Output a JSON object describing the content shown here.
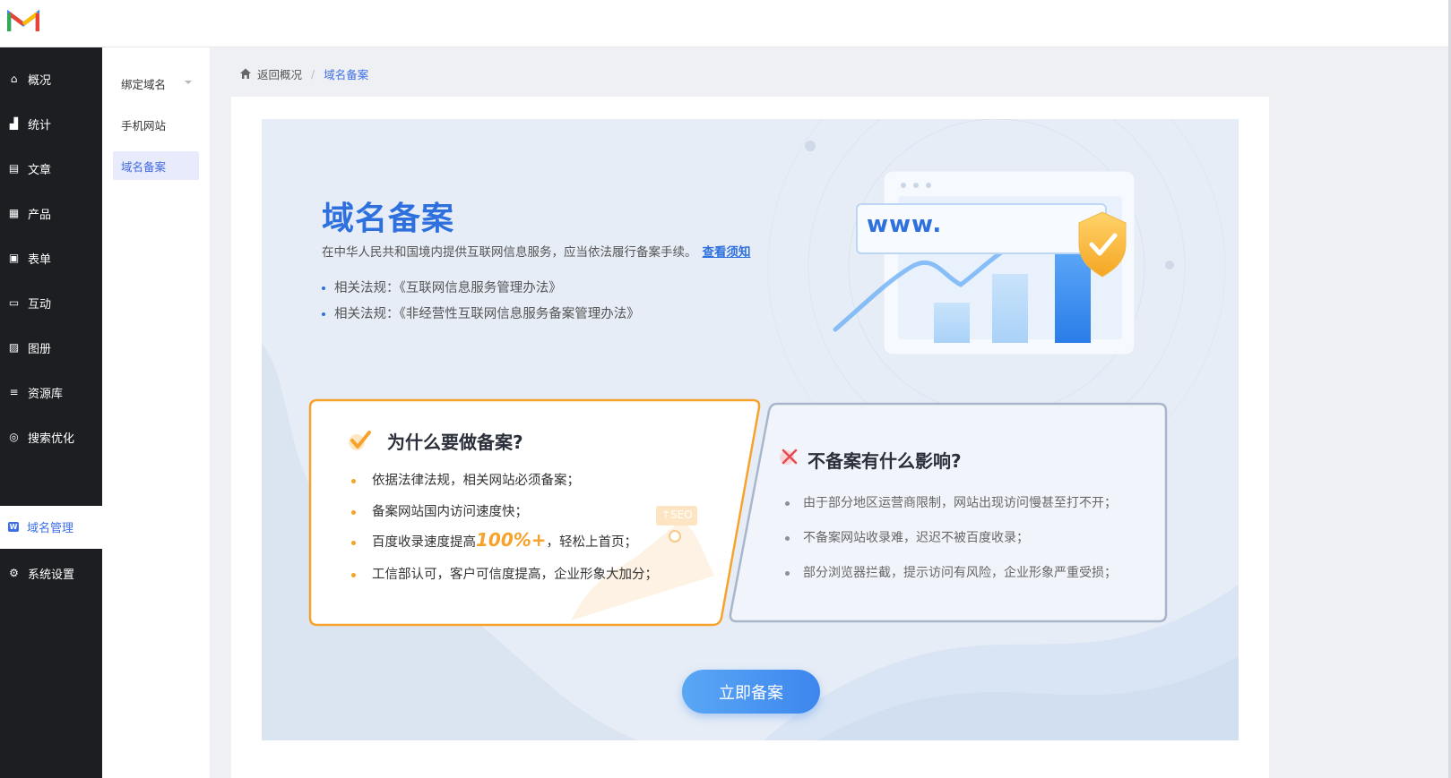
{
  "topbar": {
    "logo": "M-logo"
  },
  "sidebar": {
    "items": [
      {
        "label": "概况",
        "icon": "home-icon"
      },
      {
        "label": "统计",
        "icon": "stats-icon"
      },
      {
        "label": "文章",
        "icon": "article-icon"
      },
      {
        "label": "产品",
        "icon": "grid-icon"
      },
      {
        "label": "表单",
        "icon": "form-icon"
      },
      {
        "label": "互动",
        "icon": "chat-icon"
      },
      {
        "label": "图册",
        "icon": "gallery-icon"
      },
      {
        "label": "资源库",
        "icon": "database-icon"
      },
      {
        "label": "搜索优化",
        "icon": "seo-icon"
      },
      {
        "label": "域名管理",
        "icon": "domain-icon",
        "badge": "W",
        "active": true
      },
      {
        "label": "系统设置",
        "icon": "gear-icon"
      }
    ]
  },
  "submenu": {
    "items": [
      {
        "label": "绑定域名"
      },
      {
        "label": "手机网站"
      },
      {
        "label": "域名备案",
        "active": true
      }
    ]
  },
  "breadcrumb": {
    "back": "返回概况",
    "sep": "/",
    "current": "域名备案"
  },
  "hero": {
    "title": "域名备案",
    "desc": "在中华人民共和国境内提供互联网信息服务，应当依法履行备案手续。",
    "link": "查看须知",
    "laws": [
      "相关法规：《互联网信息服务管理办法》",
      "相关法规：《非经营性互联网信息服务备案管理办法》"
    ],
    "illustration": {
      "url_text": "www.",
      "seo_tag": "↑SEO"
    }
  },
  "why": {
    "title": "为什么要做备案?",
    "items": [
      "依据法律法规，相关网站必须备案；",
      "备案网站国内访问速度快；",
      "工信部认可，客户可信度提高，企业形象大加分；"
    ],
    "speed_prefix": "百度收录速度提高",
    "speed_pct": "100%+",
    "speed_suffix": "，轻松上首页；"
  },
  "impact": {
    "title": "不备案有什么影响?",
    "items": [
      "由于部分地区运营商限制，网站出现访问慢甚至打不开；",
      "不备案网站收录难，迟迟不被百度收录；",
      "部分浏览器拦截，提示访问有风险，企业形象严重受损；"
    ]
  },
  "cta": {
    "label": "立即备案"
  },
  "colors": {
    "accent": "#2f70df",
    "orange": "#f7a22b",
    "sidebar": "#1d1e22"
  }
}
